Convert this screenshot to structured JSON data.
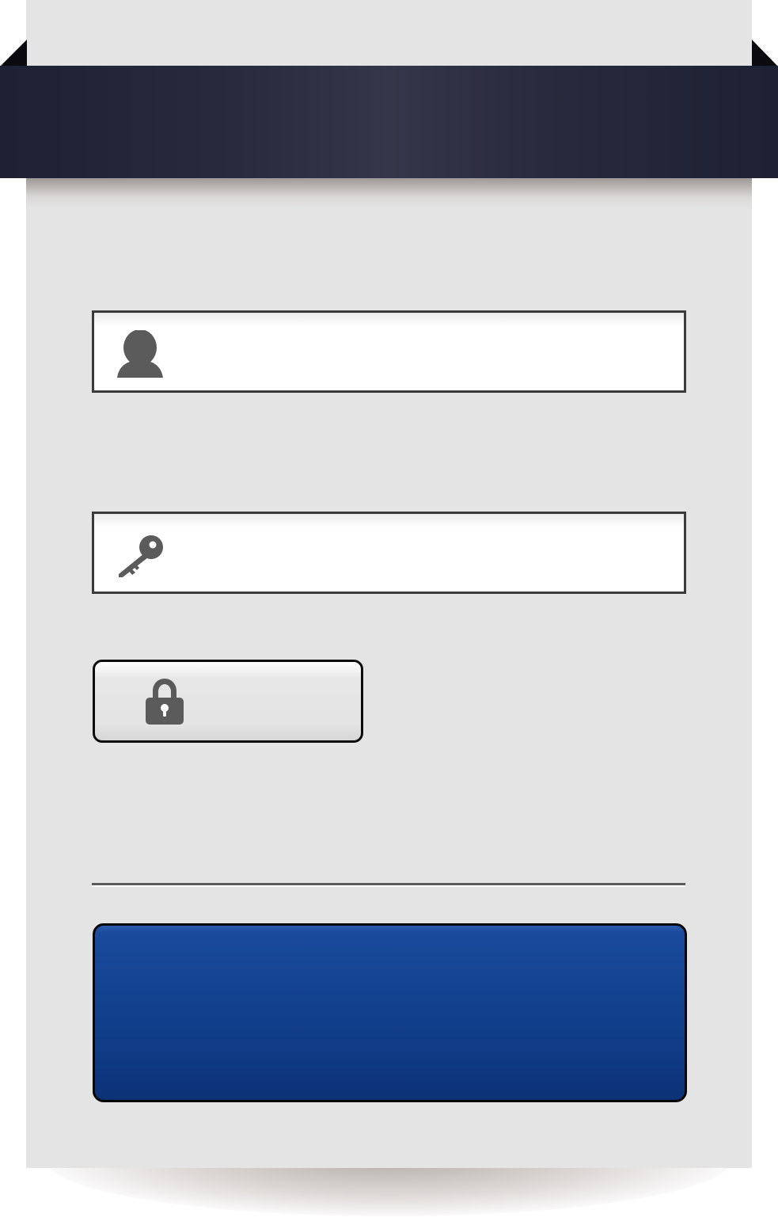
{
  "header": {
    "title": ""
  },
  "form": {
    "username": {
      "icon": "user-icon",
      "value": "",
      "placeholder": ""
    },
    "password": {
      "icon": "key-icon",
      "value": "",
      "placeholder": ""
    },
    "lock_button": {
      "icon": "lock-icon",
      "label": ""
    },
    "submit_button": {
      "label": ""
    }
  },
  "colors": {
    "ribbon": "#282a3d",
    "card_background": "#e4e4e4",
    "submit_button": "#13428f",
    "icon_gray": "#5b5b5b",
    "field_border": "#3a3a3a"
  }
}
